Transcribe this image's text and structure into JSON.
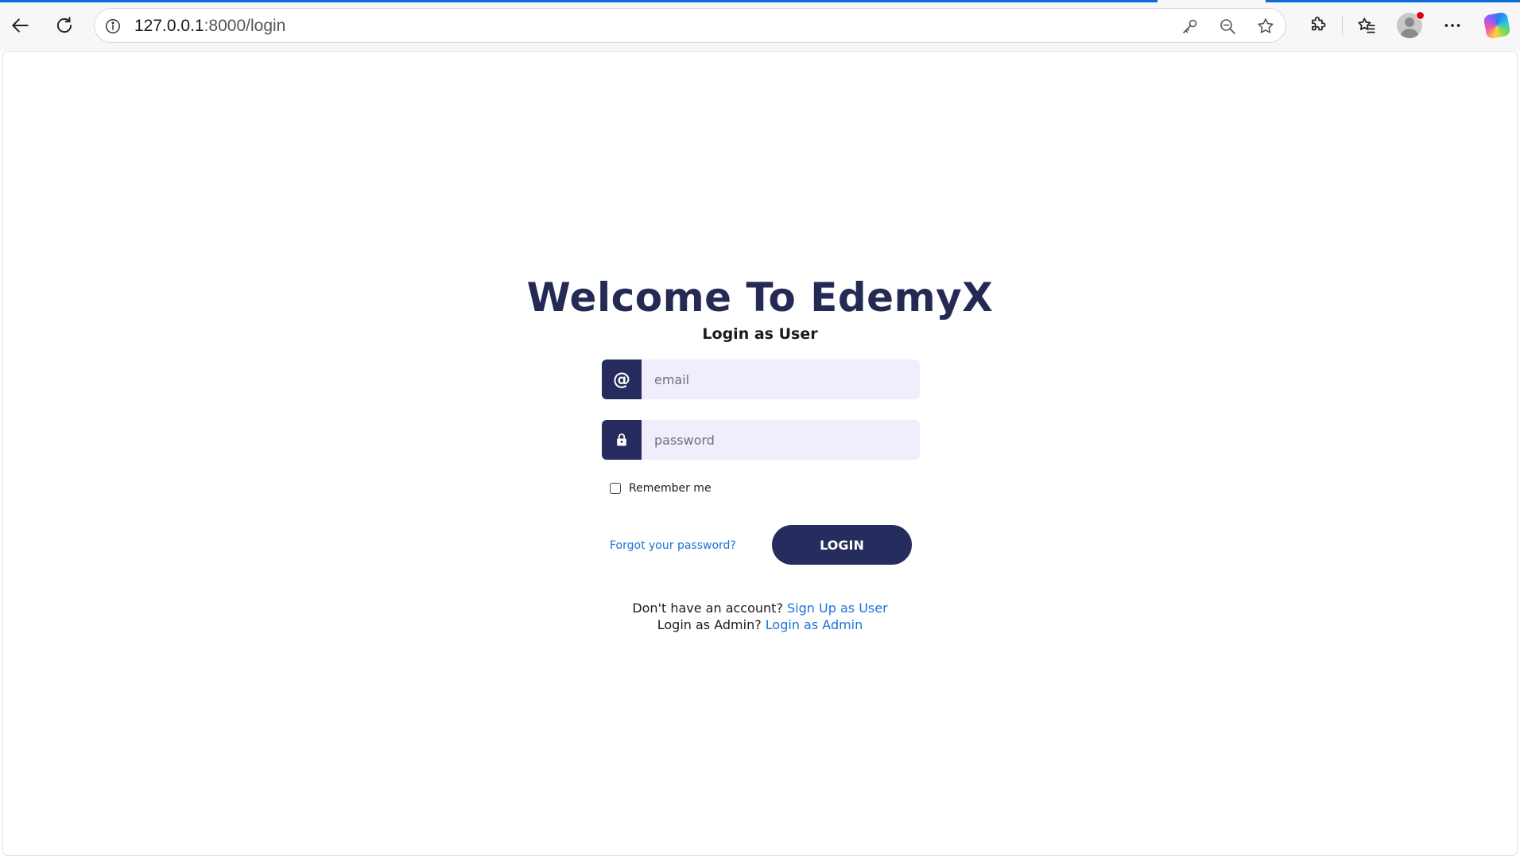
{
  "browser": {
    "url_host": "127.0.0.1",
    "url_path": ":8000/login",
    "icons": {
      "back": "back-arrow-icon",
      "reload": "reload-icon",
      "site_info": "info-icon",
      "password_key": "key-icon",
      "zoom_out": "zoom-out-icon",
      "favorite": "star-icon",
      "extensions": "puzzle-icon",
      "favorites_list": "favorites-icon",
      "profile": "avatar",
      "menu": "more-icon",
      "copilot": "copilot-icon"
    }
  },
  "login": {
    "title": "Welcome To EdemyX",
    "subtitle": "Login as User",
    "email_icon_glyph": "@",
    "email_placeholder": "email",
    "password_placeholder": "password",
    "remember_label": "Remember me",
    "forgot_label": "Forgot your password?",
    "login_button": "LOGIN",
    "signup_prompt": "Don't have an account?",
    "signup_link": "Sign Up as User",
    "admin_prompt": "Login as Admin?",
    "admin_link": "Login as Admin"
  },
  "colors": {
    "primary": "#272c5e",
    "input_bg": "#f0eefd",
    "link": "#1a73d9",
    "loading_bar": "#0a6cd6"
  }
}
